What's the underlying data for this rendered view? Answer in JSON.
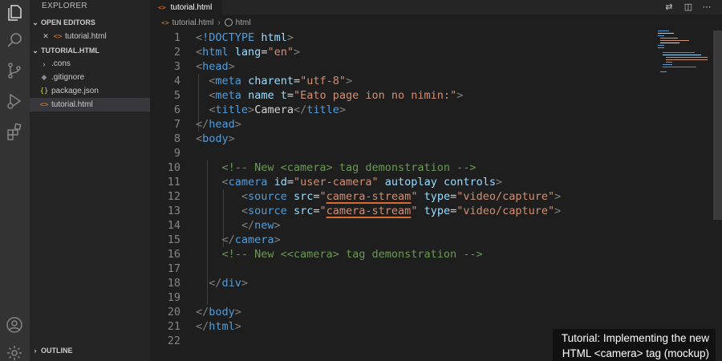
{
  "explorer": {
    "title": "EXPLORER",
    "open_editors_label": "OPEN EDITORS",
    "open_editors": [
      {
        "name": "tutorial.html",
        "icon": "html-file-icon"
      }
    ],
    "folder_label": "TUTORIAL.HTML",
    "files": [
      {
        "name": ".cons",
        "icon": "chevron-right-icon"
      },
      {
        "name": ".gitignore",
        "icon": "git-file-icon"
      },
      {
        "name": "package.json",
        "icon": "json-file-icon"
      },
      {
        "name": "tutorial.html",
        "icon": "html-file-icon",
        "active": true
      }
    ],
    "outline_label": "OUTLINE"
  },
  "icons": {
    "html_glyph": "<>",
    "json_glyph": "{}"
  },
  "tabs": [
    {
      "label": "tutorial.html",
      "active": true
    }
  ],
  "breadcrumb": [
    "tutorial.html",
    "html"
  ],
  "editor": {
    "lines": [
      {
        "n": "1",
        "segs": [
          [
            "t-pun",
            "<"
          ],
          [
            "t-tag",
            "!DOCTYPE"
          ],
          [
            "t-txt",
            " "
          ],
          [
            "t-attr",
            "html"
          ],
          [
            "t-pun",
            ">"
          ]
        ]
      },
      {
        "n": "2",
        "segs": [
          [
            "t-pun",
            "<"
          ],
          [
            "t-tag",
            "html"
          ],
          [
            "t-txt",
            " "
          ],
          [
            "t-attr",
            "lang"
          ],
          [
            "t-txt",
            "="
          ],
          [
            "t-str",
            "\"en\""
          ],
          [
            "t-pun",
            ">"
          ]
        ]
      },
      {
        "n": "3",
        "segs": [
          [
            "t-pun",
            "<"
          ],
          [
            "t-tag",
            "head"
          ],
          [
            "t-pun",
            ">"
          ]
        ]
      },
      {
        "n": "4",
        "segs": [
          [
            "t-txt",
            "  "
          ],
          [
            "t-pun",
            "<"
          ],
          [
            "t-tag",
            "meta"
          ],
          [
            "t-txt",
            " "
          ],
          [
            "t-attr",
            "charent"
          ],
          [
            "t-txt",
            "="
          ],
          [
            "t-str",
            "\"utf-8\""
          ],
          [
            "t-pun",
            ">"
          ]
        ]
      },
      {
        "n": "5",
        "segs": [
          [
            "t-txt",
            "  "
          ],
          [
            "t-pun",
            "<"
          ],
          [
            "t-tag",
            "meta"
          ],
          [
            "t-txt",
            " "
          ],
          [
            "t-attr",
            "name"
          ],
          [
            "t-txt",
            " "
          ],
          [
            "t-attr",
            "t"
          ],
          [
            "t-txt",
            "="
          ],
          [
            "t-str",
            "\"Eato page ion no nimin:\""
          ],
          [
            "t-pun",
            ">"
          ]
        ]
      },
      {
        "n": "6",
        "segs": [
          [
            "t-txt",
            "  "
          ],
          [
            "t-pun",
            "<"
          ],
          [
            "t-tag",
            "title"
          ],
          [
            "t-pun",
            ">"
          ],
          [
            "t-txt",
            "Camera"
          ],
          [
            "t-pun",
            "</"
          ],
          [
            "t-tag",
            "title"
          ],
          [
            "t-pun",
            ">"
          ]
        ]
      },
      {
        "n": "7",
        "segs": [
          [
            "t-pun",
            "</"
          ],
          [
            "t-tag",
            "head"
          ],
          [
            "t-pun",
            ">"
          ]
        ]
      },
      {
        "n": "8",
        "segs": [
          [
            "t-pun",
            "<"
          ],
          [
            "t-tag",
            "body"
          ],
          [
            "t-pun",
            ">"
          ]
        ]
      },
      {
        "n": "9",
        "segs": []
      },
      {
        "n": "10",
        "segs": [
          [
            "t-txt",
            "    "
          ],
          [
            "t-com",
            "<!-- New <camera> tag demonstration -->"
          ]
        ]
      },
      {
        "n": "11",
        "segs": [
          [
            "t-txt",
            "    "
          ],
          [
            "t-pun",
            "<"
          ],
          [
            "t-tag",
            "camera"
          ],
          [
            "t-txt",
            " "
          ],
          [
            "t-attr",
            "id"
          ],
          [
            "t-txt",
            "="
          ],
          [
            "t-str",
            "\"user-camera\""
          ],
          [
            "t-txt",
            " "
          ],
          [
            "t-attr",
            "autoplay"
          ],
          [
            "t-txt",
            " "
          ],
          [
            "t-attr",
            "controls"
          ],
          [
            "t-pun",
            ">"
          ]
        ]
      },
      {
        "n": "12",
        "segs": [
          [
            "t-txt",
            "       "
          ],
          [
            "t-pun",
            "<"
          ],
          [
            "t-tag",
            "source"
          ],
          [
            "t-txt",
            " "
          ],
          [
            "t-attr",
            "src"
          ],
          [
            "t-txt",
            "="
          ],
          [
            "t-str",
            "\""
          ],
          [
            "t-str t-err",
            "camera-stream"
          ],
          [
            "t-str",
            "\""
          ],
          [
            "t-txt",
            " "
          ],
          [
            "t-attr",
            "type"
          ],
          [
            "t-txt",
            "="
          ],
          [
            "t-str",
            "\"video/capture\""
          ],
          [
            "t-pun",
            ">"
          ]
        ]
      },
      {
        "n": "13",
        "segs": [
          [
            "t-txt",
            "       "
          ],
          [
            "t-pun",
            "<"
          ],
          [
            "t-tag",
            "source"
          ],
          [
            "t-txt",
            " "
          ],
          [
            "t-attr",
            "src"
          ],
          [
            "t-txt",
            "="
          ],
          [
            "t-str",
            "\""
          ],
          [
            "t-str t-err",
            "camera-stream"
          ],
          [
            "t-str",
            "\""
          ],
          [
            "t-txt",
            " "
          ],
          [
            "t-attr",
            "type"
          ],
          [
            "t-txt",
            "="
          ],
          [
            "t-str",
            "\"video/capture\""
          ],
          [
            "t-pun",
            ">"
          ]
        ]
      },
      {
        "n": "14",
        "segs": [
          [
            "t-txt",
            "       "
          ],
          [
            "t-pun",
            "</"
          ],
          [
            "t-tag",
            "new"
          ],
          [
            "t-pun",
            ">"
          ]
        ]
      },
      {
        "n": "15",
        "segs": [
          [
            "t-txt",
            "    "
          ],
          [
            "t-pun",
            "</"
          ],
          [
            "t-tag",
            "camera"
          ],
          [
            "t-pun",
            ">"
          ]
        ]
      },
      {
        "n": "16",
        "segs": [
          [
            "t-txt",
            "    "
          ],
          [
            "t-com",
            "<!-- New <<camera> tag demonstration -->"
          ]
        ]
      },
      {
        "n": "17",
        "segs": []
      },
      {
        "n": "18",
        "segs": [
          [
            "t-txt",
            "  "
          ],
          [
            "t-pun",
            "</"
          ],
          [
            "t-tag",
            "div"
          ],
          [
            "t-pun",
            ">"
          ]
        ]
      },
      {
        "n": "19",
        "segs": []
      },
      {
        "n": "20",
        "segs": [
          [
            "t-pun",
            "</"
          ],
          [
            "t-tag",
            "body"
          ],
          [
            "t-pun",
            ">"
          ]
        ]
      },
      {
        "n": "21",
        "segs": [
          [
            "t-pun",
            "</"
          ],
          [
            "t-tag",
            "html"
          ],
          [
            "t-pun",
            ">"
          ]
        ]
      },
      {
        "n": "22",
        "segs": []
      }
    ]
  },
  "caption": {
    "line1": "Tutorial: Implementing the new",
    "line2": "HTML <camera> tag (mockup)"
  },
  "colors": {
    "accent_file": "#e37933",
    "tag": "#569cd6",
    "attribute": "#9cdcfe",
    "string": "#ce9178",
    "comment": "#6a9955",
    "error_underline": "#d66b2f"
  }
}
